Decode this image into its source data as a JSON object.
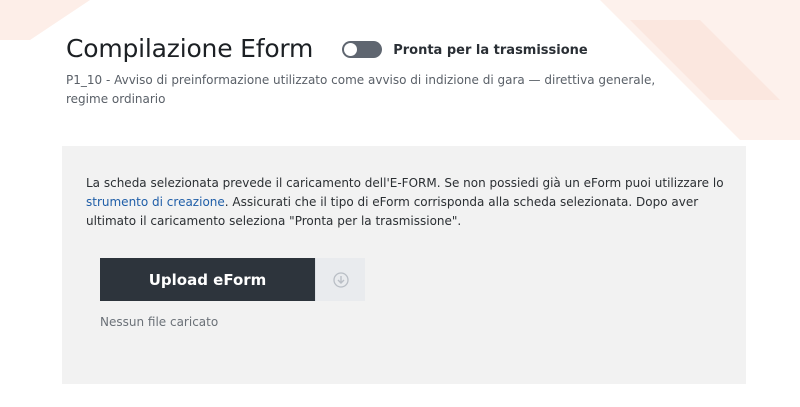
{
  "header": {
    "title": "Compilazione Eform",
    "toggle": {
      "state": "off",
      "label": "Pronta per la trasmissione"
    },
    "subtitle": "P1_10 - Avviso di preinformazione utilizzato come avviso di indizione di gara — direttiva generale, regime ordinario"
  },
  "panel": {
    "notice_part1": "La scheda selezionata prevede il caricamento dell'E-FORM. Se non possiedi già un eForm puoi utilizzare lo ",
    "notice_link": "strumento di creazione",
    "notice_part2": ". Assicurati che il tipo di eForm corrisponda alla scheda selezionata. Dopo aver ultimato il caricamento seleziona \"Pronta per la trasmissione\".",
    "upload_label": "Upload eForm",
    "download_icon": "download-icon",
    "file_status": "Nessun file caricato"
  },
  "colors": {
    "upload_button": "#2d343c",
    "link": "#1f5ea8",
    "panel_bg": "#f2f2f2",
    "toggle_off": "#5f6670"
  }
}
